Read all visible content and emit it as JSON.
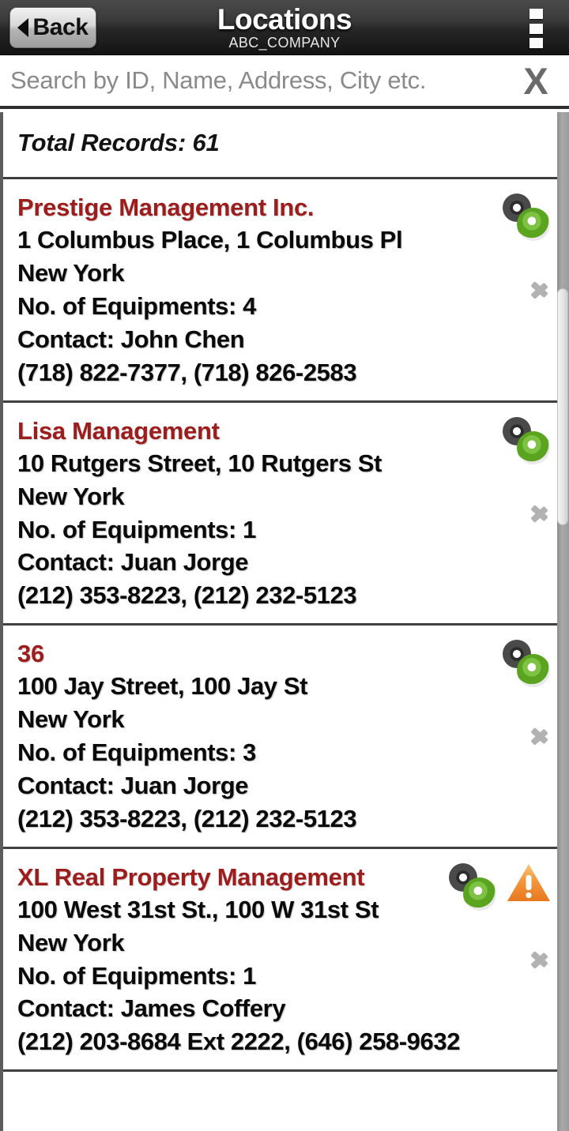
{
  "header": {
    "back_label": "Back",
    "title": "Locations",
    "subtitle": "ABC_COMPANY",
    "overflow_icon": "overflow-menu-icon",
    "back_icon": "back-arrow-icon"
  },
  "search": {
    "value": "",
    "placeholder": "Search by ID, Name, Address, City etc.",
    "clear_label": "X"
  },
  "summary": {
    "total_records_label": "Total Records: 61"
  },
  "colors": {
    "record_title": "#9d1c1c",
    "header_bg": "#2e2e2e",
    "gear_green": "#5aa420",
    "warning_orange": "#f0932b"
  },
  "records": [
    {
      "name": "Prestige Management Inc.",
      "address": "1 Columbus Place, 1 Columbus Pl",
      "city": "New York",
      "equipments": "No. of Equipments: 4",
      "contact": "Contact: John Chen",
      "phones": "(718) 822-7377, (718) 826-2583",
      "has_warning": false,
      "gear_icon": "settings-gears-icon",
      "chevron_icon": "chevron-right-icon"
    },
    {
      "name": "Lisa Management",
      "address": "10 Rutgers Street, 10 Rutgers St",
      "city": "New York",
      "equipments": "No. of Equipments: 1",
      "contact": "Contact: Juan Jorge",
      "phones": "(212) 353-8223, (212) 232-5123",
      "has_warning": false,
      "gear_icon": "settings-gears-icon",
      "chevron_icon": "chevron-right-icon"
    },
    {
      "name": "36",
      "address": "100 Jay Street, 100 Jay St",
      "city": "New York",
      "equipments": "No. of Equipments: 3",
      "contact": "Contact: Juan Jorge",
      "phones": "(212) 353-8223, (212) 232-5123",
      "has_warning": false,
      "gear_icon": "settings-gears-icon",
      "chevron_icon": "chevron-right-icon"
    },
    {
      "name": "XL Real Property Management",
      "address": "100 West 31st St., 100 W 31st St",
      "city": "New York",
      "equipments": "No. of Equipments: 1",
      "contact": "Contact: James Coffery",
      "phones": "(212) 203-8684 Ext 2222, (646) 258-9632",
      "has_warning": true,
      "gear_icon": "settings-gears-icon",
      "warning_icon": "warning-triangle-icon",
      "chevron_icon": "chevron-right-icon"
    }
  ]
}
